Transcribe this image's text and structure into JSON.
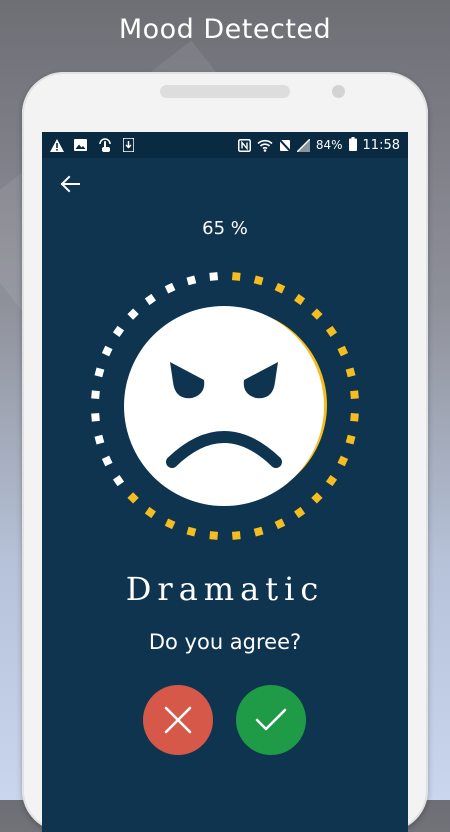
{
  "headline": "Mood Detected",
  "status_bar": {
    "battery": "84%",
    "time": "11:58",
    "left_icons": [
      "warning-icon",
      "image-icon",
      "touch-icon",
      "download-icon"
    ],
    "right_icons": [
      "nfc-icon",
      "wifi-icon",
      "no-signal-icon",
      "signal-icon"
    ]
  },
  "app": {
    "back_icon": "arrow-left-icon",
    "confidence": "65 %",
    "confidence_value": 0.65,
    "mood": "Dramatic",
    "question": "Do you agree?",
    "reject_icon": "close-icon",
    "accept_icon": "check-icon"
  },
  "colors": {
    "screen_bg": "#0f3450",
    "statusbar_bg": "#0a2a41",
    "accent_yellow": "#f5bd1f",
    "reject": "#d65848",
    "accept": "#1f9a47"
  }
}
